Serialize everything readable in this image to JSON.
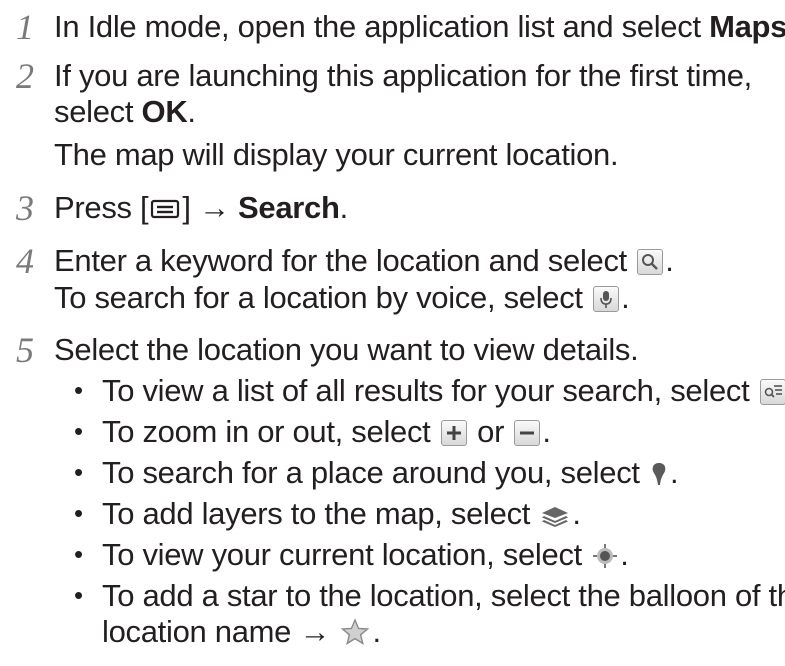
{
  "steps": [
    {
      "num": "1",
      "text_a": "In Idle mode, open the application list and select ",
      "bold": "Maps",
      "text_b": "."
    },
    {
      "num": "2",
      "line1": "If you are launching this application for the first time,",
      "line2_a": "select ",
      "line2_bold": "OK",
      "line2_b": ".",
      "line3": "The map will display your current location."
    },
    {
      "num": "3",
      "text_a": "Press [",
      "text_mid": "] → ",
      "bold": "Search",
      "text_b": "."
    },
    {
      "num": "4",
      "line1_a": "Enter a keyword for the location and select ",
      "line1_b": ".",
      "line2_a": "To search for a location by voice, select ",
      "line2_b": "."
    },
    {
      "num": "5",
      "line1": "Select the location you want to view details."
    }
  ],
  "bullets": [
    {
      "dot": "•",
      "text_a": "To view a list of all results for your search, select ",
      "text_b": "."
    },
    {
      "dot": "•",
      "text_a": "To zoom in or out, select ",
      "text_mid": " or ",
      "text_b": "."
    },
    {
      "dot": "•",
      "text_a": "To search for a place around you, select ",
      "text_b": "."
    },
    {
      "dot": "•",
      "text_a": "To add layers to the map, select ",
      "text_b": "."
    },
    {
      "dot": "•",
      "text_a": "To view your current location, select ",
      "text_b": "."
    },
    {
      "dot": "•",
      "text_a": "To add a star to the location, select the balloon of the",
      "line2_a": "location name → ",
      "line2_b": "."
    }
  ],
  "icons": {
    "menu": "menu-key-icon",
    "search": "search-icon",
    "mic": "microphone-icon",
    "list": "results-list-icon",
    "zoom_in": "zoom-in-icon",
    "zoom_out": "zoom-out-icon",
    "places": "places-pin-icon",
    "layers": "layers-icon",
    "location": "my-location-icon",
    "star": "star-icon"
  },
  "colors": {
    "text": "#231f20",
    "step_number": "#7a7a7a"
  }
}
